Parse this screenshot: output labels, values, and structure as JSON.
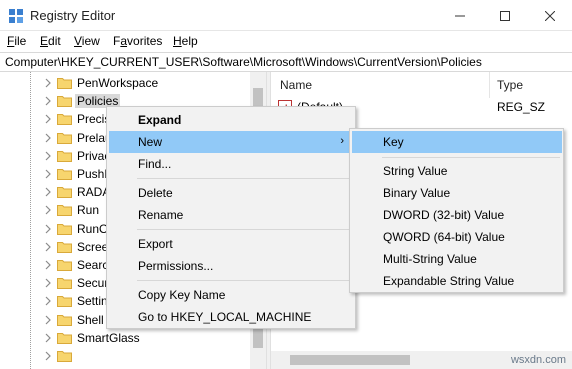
{
  "window": {
    "title": "Registry Editor",
    "minimize_label": "",
    "maximize_label": "",
    "close_label": ""
  },
  "menubar": {
    "items": [
      {
        "prefix": "",
        "accel": "F",
        "rest": "ile"
      },
      {
        "prefix": "",
        "accel": "E",
        "rest": "dit"
      },
      {
        "prefix": "",
        "accel": "V",
        "rest": "iew"
      },
      {
        "prefix": "F",
        "accel": "a",
        "rest": "vorites"
      },
      {
        "prefix": "",
        "accel": "H",
        "rest": "elp"
      }
    ]
  },
  "address": {
    "path": "Computer\\HKEY_CURRENT_USER\\Software\\Microsoft\\Windows\\CurrentVersion\\Policies"
  },
  "tree": {
    "items": [
      {
        "label": "PenWorkspace",
        "selected": false
      },
      {
        "label": "Policies",
        "selected": true
      },
      {
        "label": "Precis",
        "selected": false
      },
      {
        "label": "Prelau",
        "selected": false
      },
      {
        "label": "Privac",
        "selected": false
      },
      {
        "label": "PushN",
        "selected": false
      },
      {
        "label": "RADAR",
        "selected": false
      },
      {
        "label": "Run",
        "selected": false
      },
      {
        "label": "RunOn",
        "selected": false
      },
      {
        "label": "Screen",
        "selected": false
      },
      {
        "label": "Search",
        "selected": false
      },
      {
        "label": "Securi",
        "selected": false
      },
      {
        "label": "Setting",
        "selected": false
      },
      {
        "label": "Shell E",
        "selected": false
      },
      {
        "label": "SmartGlass",
        "selected": false
      },
      {
        "label": "",
        "selected": false
      }
    ]
  },
  "values_pane": {
    "col_name": "Name",
    "col_type": "Type",
    "rows": [
      {
        "name": "(Default)",
        "type": "REG_SZ"
      }
    ]
  },
  "context_menu": {
    "items": [
      {
        "label": "Expand",
        "bold": true
      },
      {
        "label": "New",
        "submenu": true
      },
      {
        "label": "Find..."
      },
      {
        "label": "Delete"
      },
      {
        "label": "Rename"
      },
      {
        "label": "Export"
      },
      {
        "label": "Permissions..."
      },
      {
        "label": "Copy Key Name"
      },
      {
        "label": "Go to HKEY_LOCAL_MACHINE"
      }
    ],
    "arrow": "›"
  },
  "submenu": {
    "items": [
      {
        "label": "Key"
      },
      {
        "label": "String Value"
      },
      {
        "label": "Binary Value"
      },
      {
        "label": "DWORD (32-bit) Value"
      },
      {
        "label": "QWORD (64-bit) Value"
      },
      {
        "label": "Multi-String Value"
      },
      {
        "label": "Expandable String Value"
      }
    ]
  },
  "watermark": "wsxdn.com",
  "colors": {
    "highlight": "#91c9f7",
    "menu_bg": "#f2f2f2",
    "folder": "#f7d56e",
    "selected_tree": "#d9d9d9"
  },
  "icons": {
    "app": "registry-editor-icon",
    "folder": "folder-icon",
    "chevron": "chevron-right-icon",
    "value": "reg-string-value-icon"
  }
}
